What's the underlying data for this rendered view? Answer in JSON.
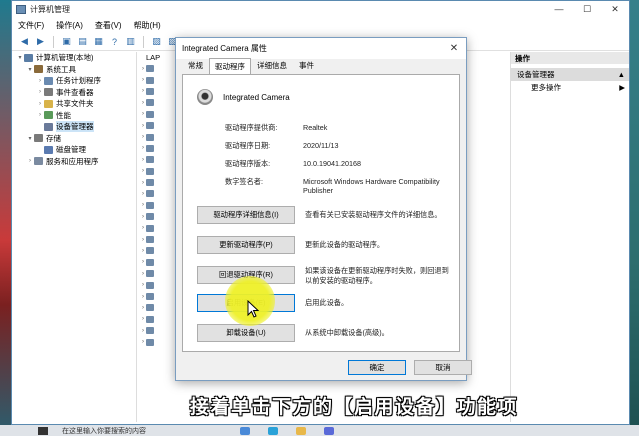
{
  "mmc": {
    "title": "计算机管理",
    "menu": [
      "文件(F)",
      "操作(A)",
      "查看(V)",
      "帮助(H)"
    ],
    "tree": [
      {
        "label": "计算机管理(本地)",
        "indent": 0,
        "arrow": "▾",
        "color": "#5a7da5"
      },
      {
        "label": "系统工具",
        "indent": 1,
        "arrow": "▾",
        "color": "#8a6a3a"
      },
      {
        "label": "任务计划程序",
        "indent": 2,
        "arrow": "›",
        "color": "#6a8ab0"
      },
      {
        "label": "事件查看器",
        "indent": 2,
        "arrow": "›",
        "color": "#7a7a7a"
      },
      {
        "label": "共享文件夹",
        "indent": 2,
        "arrow": "›",
        "color": "#d8b34a"
      },
      {
        "label": "性能",
        "indent": 2,
        "arrow": "›",
        "color": "#5a9a5a"
      },
      {
        "label": "设备管理器",
        "indent": 2,
        "arrow": "",
        "color": "#6a7a9a",
        "selected": true
      },
      {
        "label": "存储",
        "indent": 1,
        "arrow": "▾",
        "color": "#7a7a7a"
      },
      {
        "label": "磁盘管理",
        "indent": 2,
        "arrow": "",
        "color": "#5a7ab0"
      },
      {
        "label": "服务和应用程序",
        "indent": 1,
        "arrow": "›",
        "color": "#7a8aa0"
      }
    ],
    "devices_root": "LAP",
    "actions": {
      "header": "操作",
      "selected": "设备管理器",
      "more": "更多操作"
    }
  },
  "dialog": {
    "title": "Integrated Camera 属性",
    "tabs": [
      "常规",
      "驱动程序",
      "详细信息",
      "事件"
    ],
    "active_tab": 1,
    "device_name": "Integrated Camera",
    "info": [
      {
        "k": "驱动程序提供商:",
        "v": "Realtek"
      },
      {
        "k": "驱动程序日期:",
        "v": "2020/11/13"
      },
      {
        "k": "驱动程序版本:",
        "v": "10.0.19041.20168"
      },
      {
        "k": "数字签名者:",
        "v": "Microsoft Windows Hardware Compatibility Publisher"
      }
    ],
    "buttons": [
      {
        "label": "驱动程序详细信息(I)",
        "desc": "查看有关已安装驱动程序文件的详细信息。"
      },
      {
        "label": "更新驱动程序(P)",
        "desc": "更新此设备的驱动程序。"
      },
      {
        "label": "回退驱动程序(R)",
        "desc": "如果该设备在更新驱动程序时失败，则回退到以前安装的驱动程序。"
      },
      {
        "label": "启用设备(E)",
        "desc": "启用此设备。"
      },
      {
        "label": "卸载设备(U)",
        "desc": "从系统中卸载设备(高级)。"
      }
    ],
    "ok": "确定",
    "cancel": "取消"
  },
  "caption": "接着单击下方的【启用设备】功能项",
  "taskbar": {
    "search_text": "在这里输入你要搜索的内容"
  }
}
